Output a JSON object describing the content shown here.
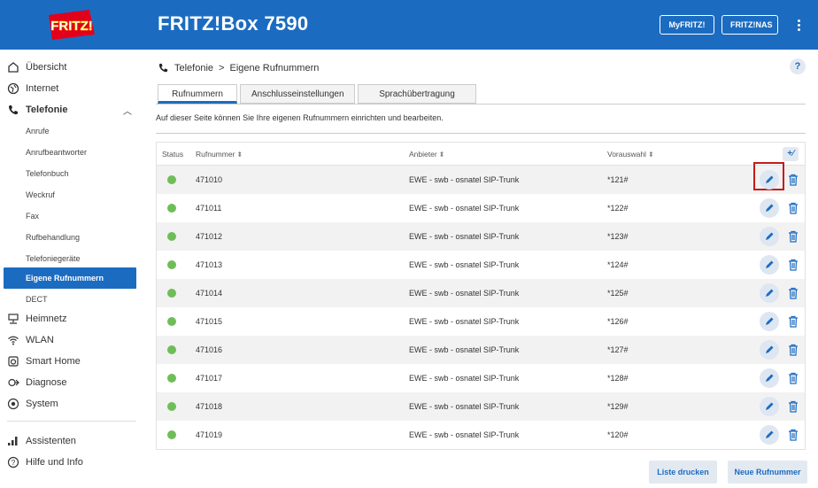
{
  "header": {
    "logo_text": "FRITZ!",
    "title": "FRITZ!Box 7590",
    "myfritz_label": "MyFRITZ!",
    "fritznas_label": "FRITZ!NAS",
    "brand_color": "#1b6cc1"
  },
  "sidebar": {
    "items": [
      {
        "label": "Übersicht",
        "icon": "home-icon"
      },
      {
        "label": "Internet",
        "icon": "globe-icon"
      },
      {
        "label": "Telefonie",
        "icon": "phone-icon"
      },
      {
        "label": "Heimnetz",
        "icon": "network-icon"
      },
      {
        "label": "WLAN",
        "icon": "wifi-icon"
      },
      {
        "label": "Smart Home",
        "icon": "smarthome-icon"
      },
      {
        "label": "Diagnose",
        "icon": "diagnose-icon"
      },
      {
        "label": "System",
        "icon": "system-icon"
      },
      {
        "label": "Assistenten",
        "icon": "assistant-icon"
      },
      {
        "label": "Hilfe und Info",
        "icon": "help-icon"
      }
    ],
    "telefonie_sub": [
      {
        "label": "Anrufe"
      },
      {
        "label": "Anrufbeantworter"
      },
      {
        "label": "Telefonbuch"
      },
      {
        "label": "Weckruf"
      },
      {
        "label": "Fax"
      },
      {
        "label": "Rufbehandlung"
      },
      {
        "label": "Telefoniegeräte"
      },
      {
        "label": "Eigene Rufnummern"
      },
      {
        "label": "DECT"
      }
    ]
  },
  "main": {
    "breadcrumb": {
      "section": "Telefonie",
      "separator": ">",
      "page": "Eigene Rufnummern"
    },
    "help_label": "?",
    "tabs": [
      {
        "label": "Rufnummern",
        "active": true
      },
      {
        "label": "Anschlusseinstellungen",
        "active": false
      },
      {
        "label": "Sprachübertragung",
        "active": false
      }
    ],
    "description": "Auf dieser Seite können Sie Ihre eigenen Rufnummern einrichten und bearbeiten.",
    "table": {
      "headers": {
        "status": "Status",
        "number": "Rufnummer",
        "provider": "Anbieter",
        "prefix": "Vorauswahl"
      },
      "add_label": "+∕",
      "rows": [
        {
          "number": "471010",
          "provider": "EWE - swb - osnatel SIP-Trunk",
          "prefix": "*121#"
        },
        {
          "number": "471011",
          "provider": "EWE - swb - osnatel SIP-Trunk",
          "prefix": "*122#"
        },
        {
          "number": "471012",
          "provider": "EWE - swb - osnatel SIP-Trunk",
          "prefix": "*123#"
        },
        {
          "number": "471013",
          "provider": "EWE - swb - osnatel SIP-Trunk",
          "prefix": "*124#"
        },
        {
          "number": "471014",
          "provider": "EWE - swb - osnatel SIP-Trunk",
          "prefix": "*125#"
        },
        {
          "number": "471015",
          "provider": "EWE - swb - osnatel SIP-Trunk",
          "prefix": "*126#"
        },
        {
          "number": "471016",
          "provider": "EWE - swb - osnatel SIP-Trunk",
          "prefix": "*127#"
        },
        {
          "number": "471017",
          "provider": "EWE - swb - osnatel SIP-Trunk",
          "prefix": "*128#"
        },
        {
          "number": "471018",
          "provider": "EWE - swb - osnatel SIP-Trunk",
          "prefix": "*129#"
        },
        {
          "number": "471019",
          "provider": "EWE - swb - osnatel SIP-Trunk",
          "prefix": "*120#"
        }
      ]
    },
    "buttons": {
      "print": "Liste drucken",
      "new": "Neue Rufnummer"
    }
  }
}
